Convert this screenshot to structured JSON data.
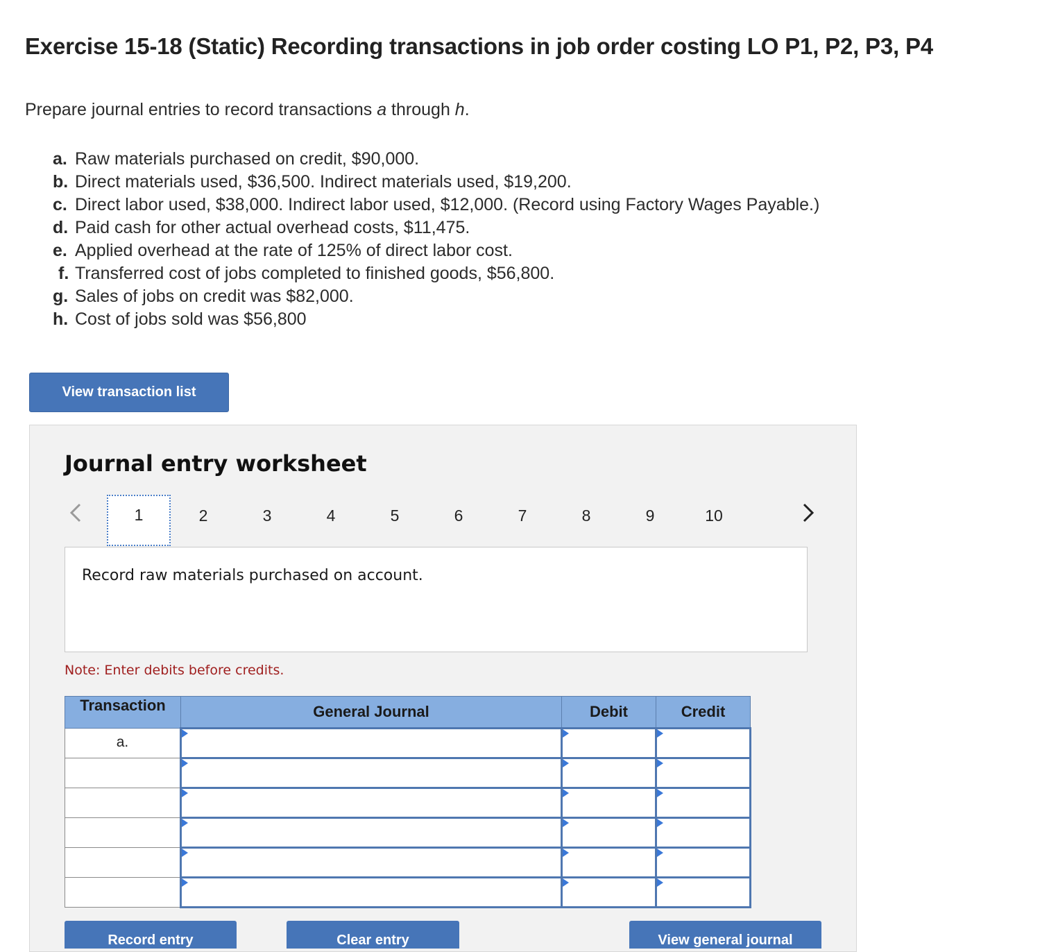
{
  "header": {
    "title": "Exercise 15-18 (Static) Recording transactions in job order costing LO P1, P2, P3, P4"
  },
  "intro": {
    "before": "Prepare journal entries to record transactions ",
    "a": "a",
    "middle": " through ",
    "h": "h",
    "after": "."
  },
  "transactions": [
    {
      "letter": "a.",
      "text": "Raw materials purchased on credit, $90,000."
    },
    {
      "letter": "b.",
      "text": "Direct materials used, $36,500. Indirect materials used, $19,200."
    },
    {
      "letter": "c.",
      "text": "Direct labor used, $38,000. Indirect labor used, $12,000. (Record using Factory Wages Payable.)"
    },
    {
      "letter": "d.",
      "text": "Paid cash for other actual overhead costs, $11,475."
    },
    {
      "letter": "e.",
      "text": "Applied overhead at the rate of 125% of direct labor cost."
    },
    {
      "letter": "f.",
      "text": "Transferred cost of jobs completed to finished goods, $56,800."
    },
    {
      "letter": "g.",
      "text": "Sales of jobs on credit was $82,000."
    },
    {
      "letter": "h.",
      "text": "Cost of jobs sold was $56,800"
    }
  ],
  "buttons": {
    "view_transaction_list": "View transaction list",
    "record_entry": "Record entry",
    "clear_entry": "Clear entry",
    "view_general_journal": "View general journal"
  },
  "worksheet": {
    "title": "Journal entry worksheet",
    "steps": [
      "1",
      "2",
      "3",
      "4",
      "5",
      "6",
      "7",
      "8",
      "9",
      "10"
    ],
    "active_step": "1",
    "prompt": "Record raw materials purchased on account.",
    "note": "Note: Enter debits before credits."
  },
  "journal_table": {
    "headers": {
      "transaction": "Transaction",
      "general_journal": "General Journal",
      "debit": "Debit",
      "credit": "Credit"
    },
    "rows": [
      {
        "transaction": "a.",
        "account": "",
        "debit": "",
        "credit": ""
      },
      {
        "transaction": "",
        "account": "",
        "debit": "",
        "credit": ""
      },
      {
        "transaction": "",
        "account": "",
        "debit": "",
        "credit": ""
      },
      {
        "transaction": "",
        "account": "",
        "debit": "",
        "credit": ""
      },
      {
        "transaction": "",
        "account": "",
        "debit": "",
        "credit": ""
      },
      {
        "transaction": "",
        "account": "",
        "debit": "",
        "credit": ""
      }
    ]
  },
  "colors": {
    "button": "#4675b8",
    "table_header": "#86aee0",
    "note": "#a02020",
    "input_border": "#4f77b0"
  },
  "icons": {
    "prev": "chevron-left-icon",
    "next": "chevron-right-icon",
    "field_marker": "triangle-right-icon"
  }
}
